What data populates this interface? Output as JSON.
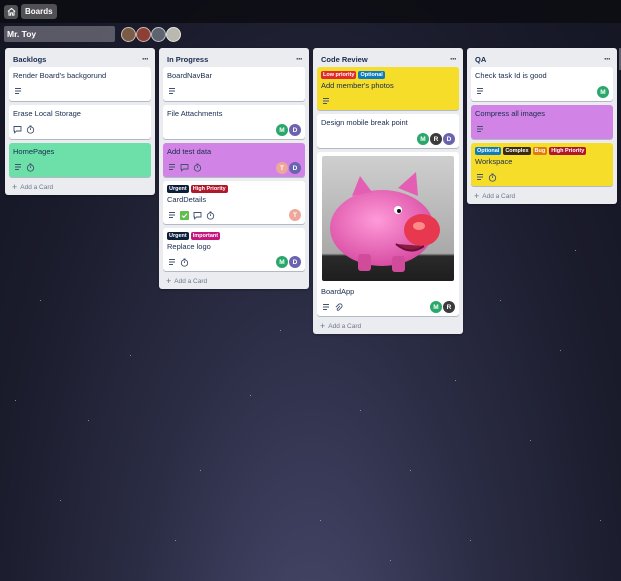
{
  "nav": {
    "boards_label": "Boards"
  },
  "board": {
    "title": "Mr. Toy"
  },
  "lists": [
    {
      "title": "Backlogs",
      "add_label": "Add a Card",
      "cards": [
        {
          "title": "Render Board's backgorund"
        },
        {
          "title": "Erase Local Storage"
        },
        {
          "title": "HomePages",
          "color": "#6ce0a8"
        }
      ]
    },
    {
      "title": "In Progress",
      "add_label": "Add a Card",
      "cards": [
        {
          "title": "BoardNavBar"
        },
        {
          "title": "File Attachments",
          "members": [
            "M",
            "D"
          ]
        },
        {
          "title": "Add test data",
          "color": "#d184e6",
          "members": [
            "T",
            "D"
          ]
        },
        {
          "title": "CardDetails",
          "labels": [
            "Urgent",
            "High Priority"
          ],
          "members": [
            "T"
          ]
        },
        {
          "title": "Replace logo",
          "labels": [
            "Urgent",
            "Important"
          ],
          "members": [
            "M",
            "D"
          ]
        }
      ]
    },
    {
      "title": "Code Review",
      "add_label": "Add a Card",
      "cards": [
        {
          "title": "Add member's photos",
          "color": "#f5dd29",
          "labels": [
            "Low priority",
            "Optional"
          ]
        },
        {
          "title": "Design mobile break point",
          "members": [
            "M",
            "R",
            "D"
          ]
        },
        {
          "title": "BoardApp",
          "members": [
            "M",
            "R"
          ]
        }
      ]
    },
    {
      "title": "QA",
      "add_label": "Add a Card",
      "cards": [
        {
          "title": "Check task Id is good",
          "members": [
            "M"
          ]
        },
        {
          "title": "Compress all images",
          "color": "#d184e6"
        },
        {
          "title": "Workspace",
          "color": "#f5dd29",
          "labels": [
            "Optional",
            "Complex",
            "Bug",
            "High Priority"
          ]
        }
      ]
    }
  ],
  "colors": {
    "label_urgent": "#0b1f3a",
    "label_high_priority": "#b0192b",
    "label_important": "#c4177d",
    "label_low_priority": "#e12a2a",
    "label_optional": "#0d7bbd",
    "label_complex": "#3a2a12",
    "label_bug": "#e07a12",
    "avatar_m": "#2aa86b",
    "avatar_d": "#6a63b0",
    "avatar_t": "#eea79a",
    "avatar_r": "#3b3b3b"
  }
}
